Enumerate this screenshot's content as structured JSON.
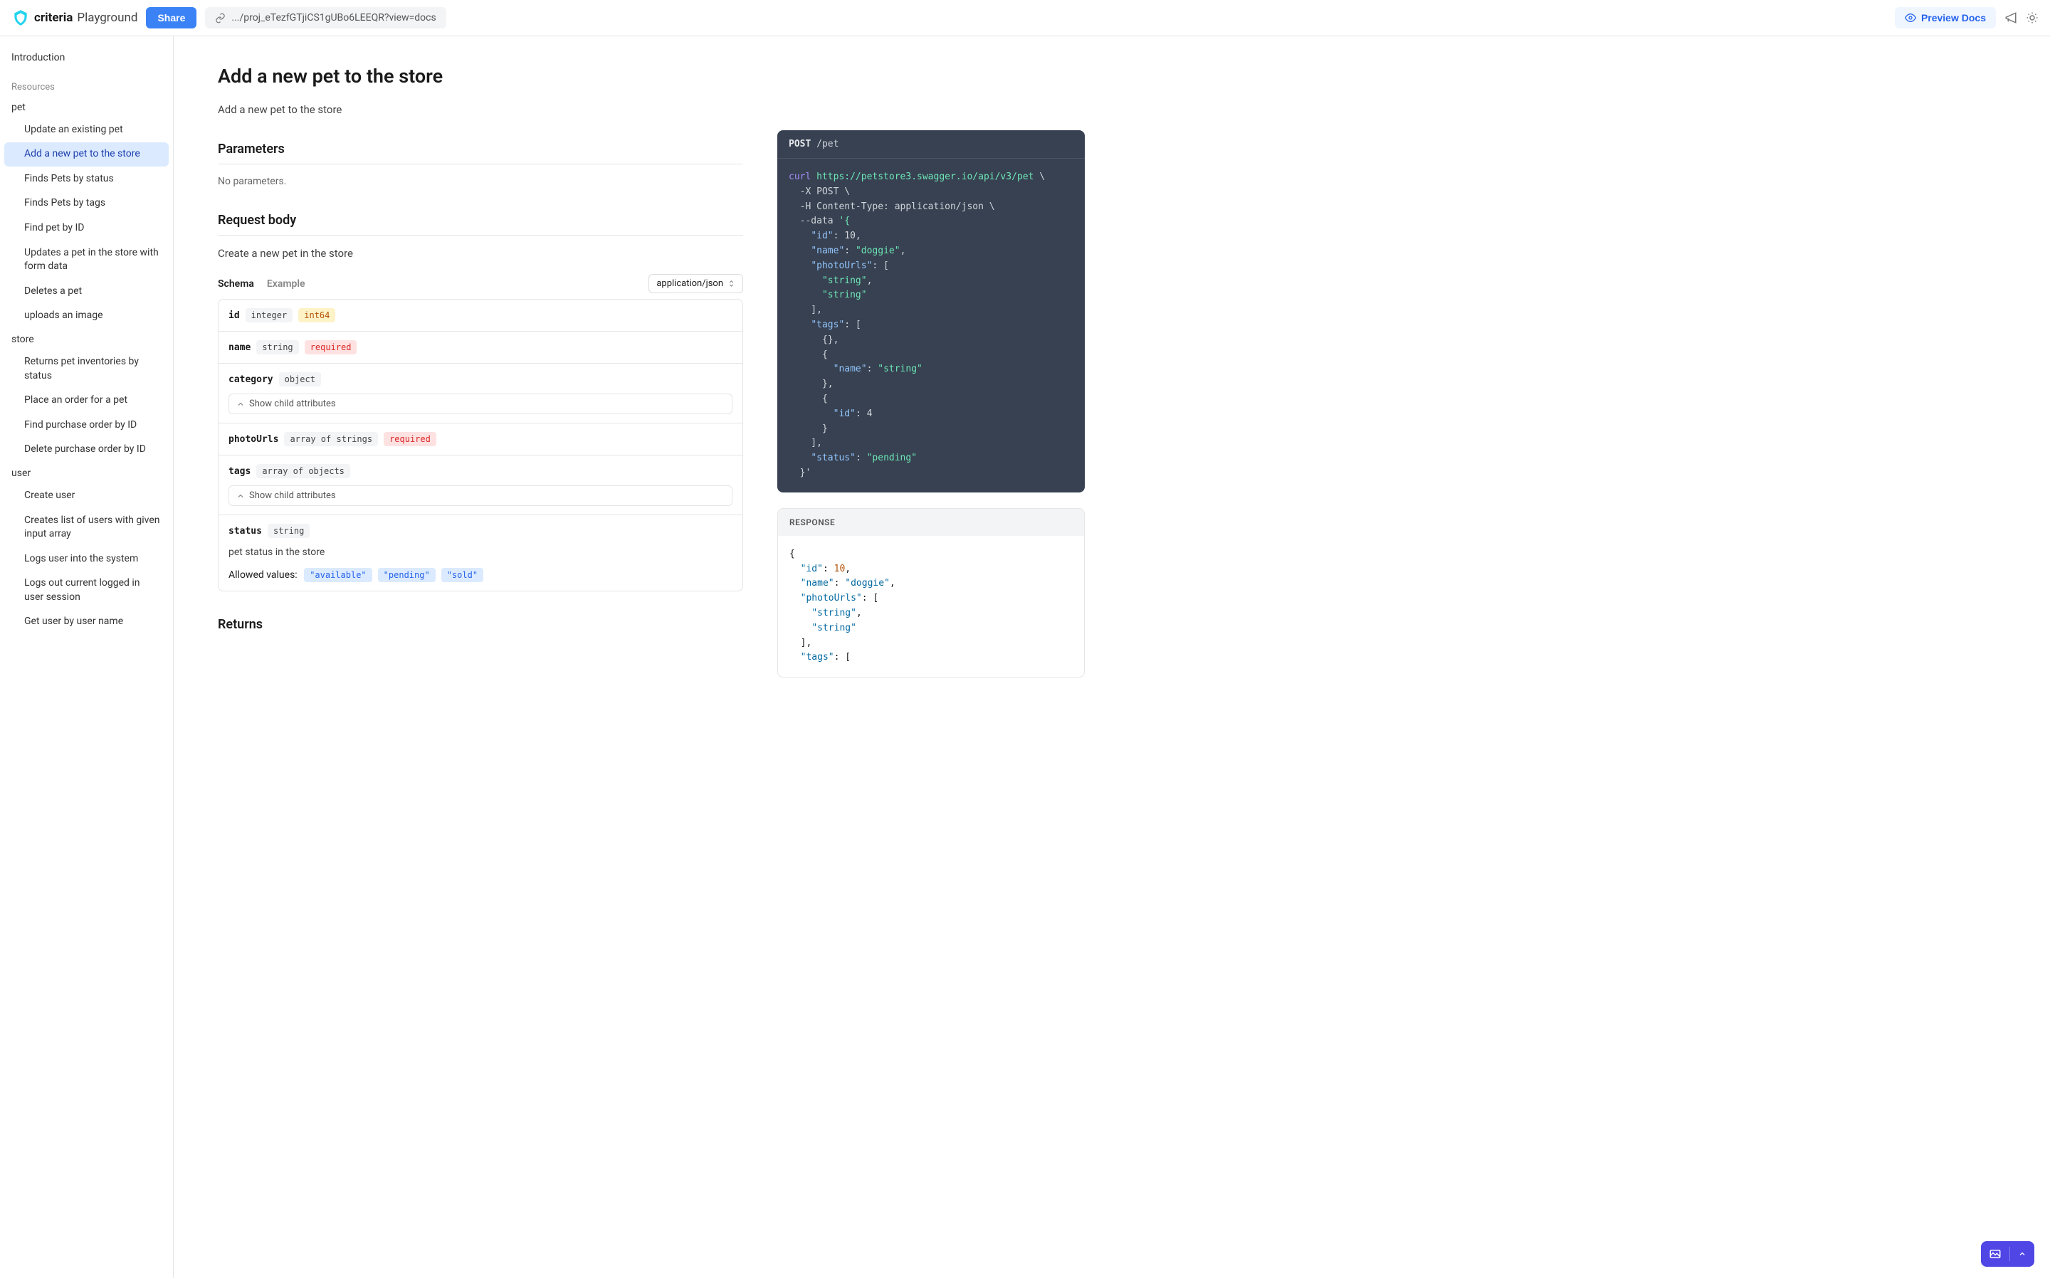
{
  "brand": {
    "main": "criteria",
    "sub": "Playground"
  },
  "header": {
    "share": "Share",
    "url": ".../proj_eTezfGTjiCS1gUBo6LEEQR?view=docs",
    "preview": "Preview Docs"
  },
  "nav": {
    "intro": "Introduction",
    "resources_label": "Resources",
    "groups": [
      {
        "name": "pet",
        "items": [
          "Update an existing pet",
          "Add a new pet to the store",
          "Finds Pets by status",
          "Finds Pets by tags",
          "Find pet by ID",
          "Updates a pet in the store with form data",
          "Deletes a pet",
          "uploads an image"
        ],
        "active_index": 1
      },
      {
        "name": "store",
        "items": [
          "Returns pet inventories by status",
          "Place an order for a pet",
          "Find purchase order by ID",
          "Delete purchase order by ID"
        ]
      },
      {
        "name": "user",
        "items": [
          "Create user",
          "Creates list of users with given input array",
          "Logs user into the system",
          "Logs out current logged in user session",
          "Get user by user name"
        ]
      }
    ]
  },
  "page": {
    "title": "Add a new pet to the store",
    "description": "Add a new pet to the store",
    "parameters_heading": "Parameters",
    "no_parameters": "No parameters.",
    "request_body_heading": "Request body",
    "request_body_desc": "Create a new pet in the store",
    "tab_schema": "Schema",
    "tab_example": "Example",
    "content_type": "application/json",
    "returns_heading": "Returns",
    "fields": {
      "id": {
        "name": "id",
        "type": "integer",
        "format": "int64"
      },
      "name": {
        "name": "name",
        "type": "string",
        "required": "required"
      },
      "category": {
        "name": "category",
        "type": "object",
        "toggle": "Show child attributes"
      },
      "photoUrls": {
        "name": "photoUrls",
        "type": "array of strings",
        "required": "required"
      },
      "tags": {
        "name": "tags",
        "type": "array of objects",
        "toggle": "Show child attributes"
      },
      "status": {
        "name": "status",
        "type": "string",
        "desc": "pet status in the store",
        "allowed_label": "Allowed values:",
        "enum": [
          "\"available\"",
          "\"pending\"",
          "\"sold\""
        ]
      }
    }
  },
  "request": {
    "method": "POST",
    "path": "/pet",
    "curl": {
      "l1": "curl https://petstore3.swagger.io/api/v3/pet \\",
      "l2": "  -X POST \\",
      "l3": "  -H Content-Type: application/json \\",
      "l4": "  --data '{",
      "l5": "    \"id\": 10,",
      "l6": "    \"name\": \"doggie\",",
      "l7": "    \"photoUrls\": [",
      "l8": "      \"string\",",
      "l9": "      \"string\"",
      "l10": "    ],",
      "l11": "    \"tags\": [",
      "l12": "      {},",
      "l13": "      {",
      "l14": "        \"name\": \"string\"",
      "l15": "      },",
      "l16": "      {",
      "l17": "        \"id\": 4",
      "l18": "      }",
      "l19": "    ],",
      "l20": "    \"status\": \"pending\"",
      "l21": "  }'"
    }
  },
  "response": {
    "header": "RESPONSE",
    "body": "{\n  \"id\": 10,\n  \"name\": \"doggie\",\n  \"photoUrls\": [\n    \"string\",\n    \"string\"\n  ],\n  \"tags\": ["
  }
}
